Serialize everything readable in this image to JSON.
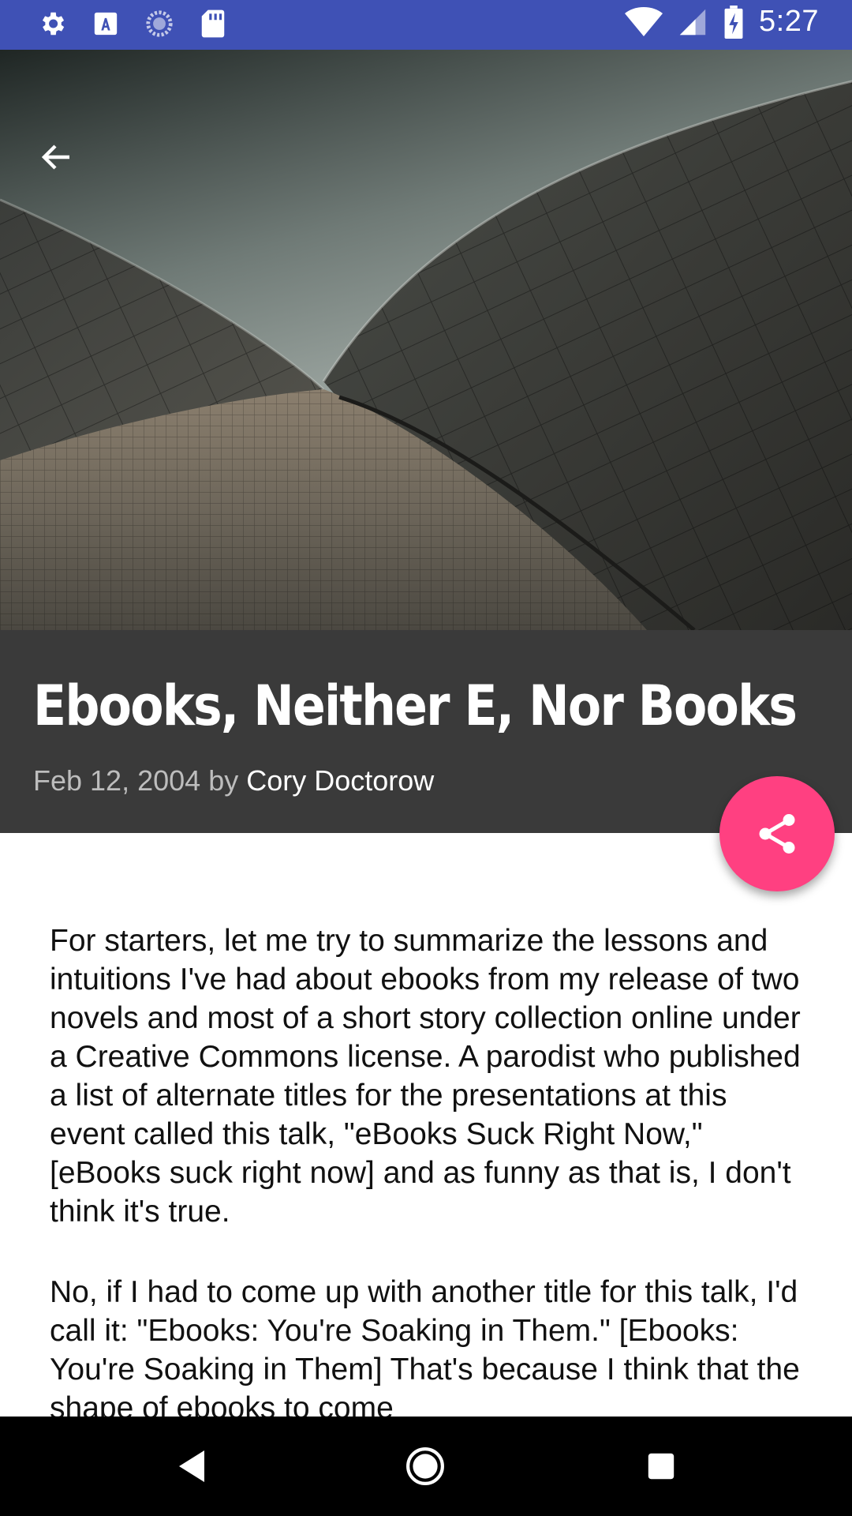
{
  "status_bar": {
    "time": "5:27",
    "left_icons": [
      "gear-icon",
      "font-a-icon",
      "sync-circle-icon",
      "sd-card-icon"
    ],
    "right_icons": [
      "wifi-icon",
      "cell-signal-icon",
      "battery-charging-icon"
    ],
    "color": "#3f51b5"
  },
  "hero": {
    "description_icon": "back-arrow-icon"
  },
  "article": {
    "title": "Ebooks, Neither E, Nor Books",
    "date": "Feb 12, 2004",
    "by": "by",
    "author": "Cory Doctorow",
    "paragraph_1": "For starters, let me try to summarize the lessons and intuitions I've had about ebooks from my release of two novels and most of a short story collection online under a Creative Commons license. A parodist who published a list of alternate titles for the presentations at this event called this talk, \"eBooks Suck Right Now,\" [eBooks suck right now] and as funny as that is, I don't think it's true.",
    "paragraph_2": "No, if I had to come up with another title for this talk, I'd call it: \"Ebooks: You're Soaking in Them.\" [Ebooks: You're Soaking in Them] That's because I think that the shape of ebooks to come"
  },
  "fab": {
    "icon": "share-icon",
    "color": "#ff4081"
  },
  "nav_bar": {
    "buttons": [
      "back-triangle-icon",
      "home-circle-icon",
      "recents-square-icon"
    ]
  }
}
